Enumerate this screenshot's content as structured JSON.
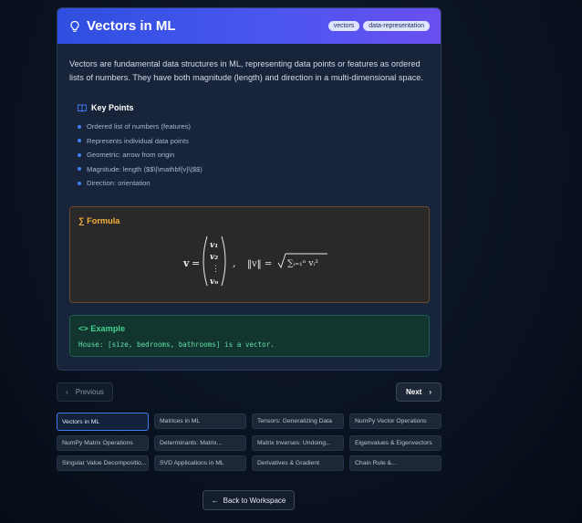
{
  "lesson": {
    "title": "Vectors in ML",
    "tags": [
      "vectors",
      "data-representation"
    ],
    "intro": "Vectors are fundamental data structures in ML, representing data points or features as ordered lists of numbers. They have both magnitude (length) and direction in a multi-dimensional space."
  },
  "key_points": {
    "title": "Key Points",
    "items": [
      "Ordered list of numbers (features)",
      "Represents individual data points",
      "Geometric: arrow from origin",
      "Magnitude: length ($$\\|\\mathbf{v}\\|$$)",
      "Direction: orientation"
    ]
  },
  "formula": {
    "title": "Formula",
    "lhs": "v",
    "components": [
      "v₁",
      "v₂",
      "⋮",
      "vₙ"
    ],
    "norm": "‖v‖ = ",
    "sum_text": "∑ᵢ₌₁ⁿ vᵢ²"
  },
  "example": {
    "title": "Example",
    "code": "House: [size, bedrooms, bathrooms] is a vector."
  },
  "navigation": {
    "previous_label": "Previous",
    "next_label": "Next",
    "back_label": "Back to Workspace"
  },
  "topics": [
    "Vectors in ML",
    "Matrices in ML",
    "Tensors: Generalizing Data",
    "NumPy Vector Operations",
    "NumPy Matrix Operations",
    "Determinants: Matrix...",
    "Matrix Inverses: Undoing...",
    "Eigenvalues & Eigenvectors",
    "Singular Value Decompositio...",
    "SVD Applications in ML",
    "Derivatives & Gradient",
    "Chain Rule &..."
  ],
  "active_topic": 0,
  "colors": {
    "header_start": "#2e4fe0",
    "header_end": "#6a4ff0",
    "formula_accent": "#f5b23a",
    "example_accent": "#3fd48f",
    "bullet": "#3f7df5"
  }
}
